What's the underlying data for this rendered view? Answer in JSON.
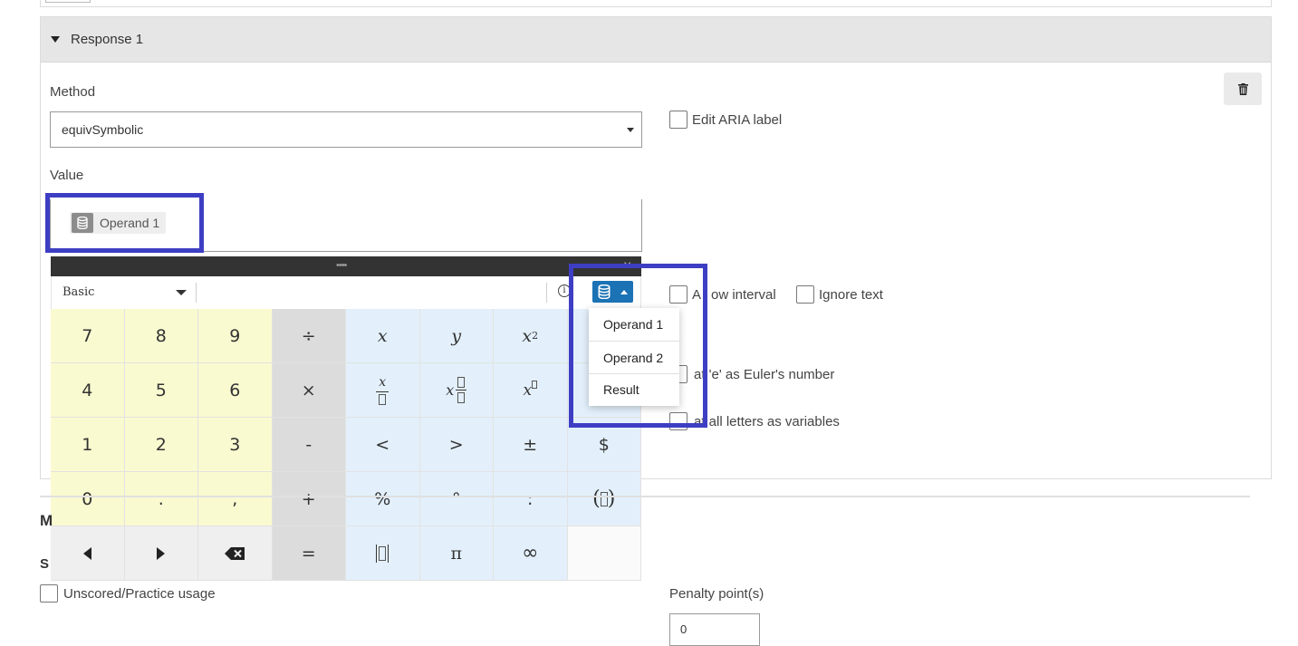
{
  "response_panel": {
    "title": "Response 1",
    "method_label": "Method",
    "method_value": "equivSymbolic",
    "value_label": "Value",
    "value_chip": "Operand 1"
  },
  "options": {
    "edit_aria_label": "Edit ARIA label",
    "allow_interval": "Allow interval",
    "allow_interval_visible": "A",
    "allow_interval_visible_tail": "ow interval",
    "ignore_text": "Ignore text",
    "treat_e_tail": "at 'e' as Euler's number",
    "treat_letters_tail": "at all letters as variables"
  },
  "keypad": {
    "mode": "Basic",
    "info": "i",
    "grip": "••••",
    "close": "×",
    "keys": {
      "k7": "7",
      "k8": "8",
      "k9": "9",
      "div": "÷",
      "x": "x",
      "y": "y",
      "k4": "4",
      "k5": "5",
      "k6": "6",
      "mul": "×",
      "k1": "1",
      "k2": "2",
      "k3": "3",
      "minus": "-",
      "lt": "<",
      "gt": ">",
      "pm": "±",
      "dollar": "$",
      "k0": "0",
      "dot": ".",
      "comma": ",",
      "plus": "+",
      "percent": "%",
      "degree": "°",
      "colon": ":",
      "eq": "=",
      "pi": "π",
      "inf": "∞"
    }
  },
  "dropdown": {
    "items": [
      "Operand 1",
      "Operand 2",
      "Result"
    ]
  },
  "bottom": {
    "unscored_label": "Unscored/Practice usage",
    "penalty_label": "Penalty point(s)",
    "penalty_value": "0",
    "clip_m": "M",
    "clip_s": "S"
  },
  "colors": {
    "highlight": "#3e3ec4",
    "keypad_button": "#1b72b5",
    "number_key": "#fafad0",
    "symbol_key": "#e3f0fb"
  },
  "icons": [
    "database-icon",
    "trash-icon",
    "caret-down-icon",
    "close-icon",
    "info-icon",
    "backspace-icon",
    "arrow-left-icon",
    "arrow-right-icon"
  ]
}
